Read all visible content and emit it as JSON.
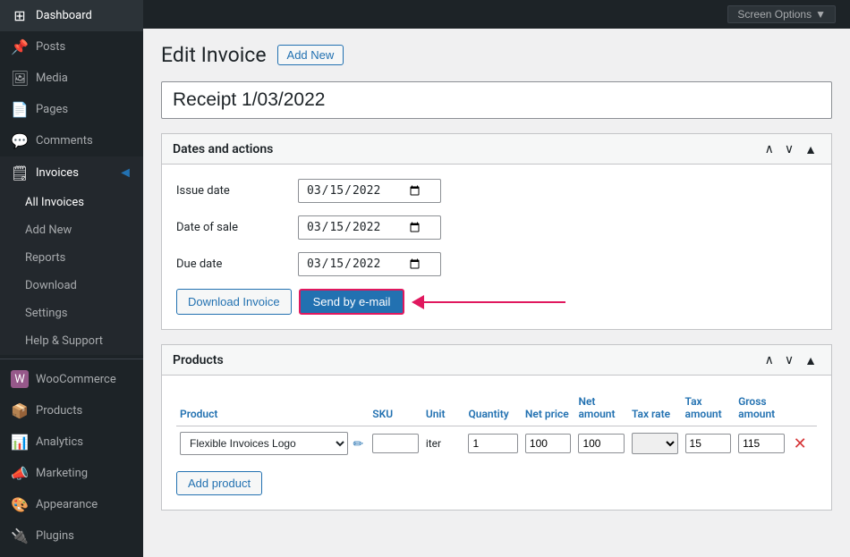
{
  "topbar": {
    "screen_options_label": "Screen Options",
    "screen_options_arrow": "▼"
  },
  "sidebar": {
    "items": [
      {
        "id": "dashboard",
        "label": "Dashboard",
        "icon": "⊞",
        "active": false
      },
      {
        "id": "posts",
        "label": "Posts",
        "icon": "📌",
        "active": false
      },
      {
        "id": "media",
        "label": "Media",
        "icon": "🖼",
        "active": false
      },
      {
        "id": "pages",
        "label": "Pages",
        "icon": "📄",
        "active": false
      },
      {
        "id": "comments",
        "label": "Comments",
        "icon": "💬",
        "active": false
      },
      {
        "id": "invoices",
        "label": "Invoices",
        "icon": "🗒",
        "active": true
      }
    ],
    "invoices_submenu": [
      {
        "id": "all-invoices",
        "label": "All Invoices",
        "active": false
      },
      {
        "id": "add-new",
        "label": "Add New",
        "active": false
      },
      {
        "id": "reports",
        "label": "Reports",
        "active": false
      },
      {
        "id": "download",
        "label": "Download",
        "active": false
      },
      {
        "id": "settings",
        "label": "Settings",
        "active": false
      },
      {
        "id": "help-support",
        "label": "Help & Support",
        "active": false
      }
    ],
    "bottom_items": [
      {
        "id": "woocommerce",
        "label": "WooCommerce",
        "icon": "Ⓦ",
        "active": false
      },
      {
        "id": "products",
        "label": "Products",
        "icon": "📦",
        "active": false
      },
      {
        "id": "analytics",
        "label": "Analytics",
        "icon": "📊",
        "active": false
      },
      {
        "id": "marketing",
        "label": "Marketing",
        "icon": "📣",
        "active": false
      },
      {
        "id": "appearance",
        "label": "Appearance",
        "icon": "🎨",
        "active": false
      },
      {
        "id": "plugins",
        "label": "Plugins",
        "icon": "🔌",
        "active": false
      }
    ]
  },
  "page": {
    "title": "Edit Invoice",
    "add_new_label": "Add New",
    "invoice_title": "Receipt 1/03/2022"
  },
  "dates_panel": {
    "title": "Dates and actions",
    "issue_date_label": "Issue date",
    "issue_date_value": "2022-03-15",
    "date_of_sale_label": "Date of sale",
    "date_of_sale_value": "2022-03-15",
    "due_date_label": "Due date",
    "due_date_value": "2022-03-15",
    "download_invoice_label": "Download Invoice",
    "send_email_label": "Send by e-mail"
  },
  "products_panel": {
    "title": "Products",
    "columns": {
      "product": "Product",
      "sku": "SKU",
      "unit": "Unit",
      "quantity": "Quantity",
      "net_price": "Net price",
      "net_amount": "Net amount",
      "tax_rate": "Tax rate",
      "tax_amount": "Tax amount",
      "gross_amount": "Gross amount"
    },
    "rows": [
      {
        "product_name": "Flexible Invoices Logo",
        "sku": "",
        "unit": "iter",
        "quantity": "1",
        "net_price": "100",
        "net_amount": "100",
        "tax_rate": "",
        "tax_amount": "15",
        "gross_amount": "115"
      }
    ],
    "add_product_label": "Add product"
  }
}
